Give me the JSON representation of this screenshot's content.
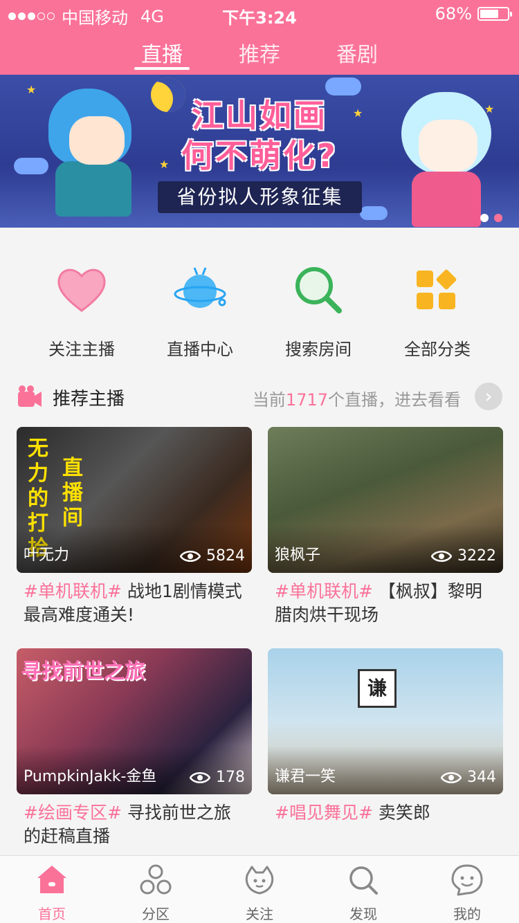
{
  "status_bar": {
    "carrier": "中国移动",
    "network": "4G",
    "time": "下午3:24",
    "battery_text": "68%",
    "battery_level": 0.68
  },
  "top_tabs": [
    {
      "label": "直播",
      "active": true
    },
    {
      "label": "推荐",
      "active": false
    },
    {
      "label": "番剧",
      "active": false
    }
  ],
  "banner": {
    "title_line1": "江山如画",
    "title_line2": "何不萌化?",
    "subtitle": "省份拟人形象征集",
    "page_index": 2,
    "page_count": 2
  },
  "quick_entries": [
    {
      "label": "关注主播",
      "icon": "heart-icon"
    },
    {
      "label": "直播中心",
      "icon": "planet-icon"
    },
    {
      "label": "搜索房间",
      "icon": "search-room-icon"
    },
    {
      "label": "全部分类",
      "icon": "category-grid-icon"
    }
  ],
  "section": {
    "title": "推荐主播",
    "prefix": "当前",
    "count": "1717",
    "suffix": "个直播，进去看看"
  },
  "cards": [
    {
      "uploader": "叶无力",
      "views": "5824",
      "tag": "#单机联机#",
      "title": " 战地1剧情模式最高难度通关!",
      "thumb_text": [
        "无",
        "力",
        "的",
        "打",
        "拾"
      ],
      "thumb_text2": [
        "直",
        "播",
        "间"
      ]
    },
    {
      "uploader": "狼枫子",
      "views": "3222",
      "tag": "#单机联机#",
      "title": " 【枫叔】黎明腊肉烘干现场"
    },
    {
      "uploader": "PumpkinJakk-金鱼",
      "views": "178",
      "tag": "#绘画专区#",
      "title": " 寻找前世之旅的赶稿直播",
      "thumb_logo": "寻找前世之旅"
    },
    {
      "uploader": "谦君一笑",
      "views": "344",
      "tag": "#唱见舞见#",
      "title": " 卖笑郎",
      "thumb_badge": "谦"
    }
  ],
  "bottom_tabs": [
    {
      "label": "首页",
      "icon": "home-icon",
      "active": true
    },
    {
      "label": "分区",
      "icon": "circles-icon",
      "active": false
    },
    {
      "label": "关注",
      "icon": "follow-face-icon",
      "active": false
    },
    {
      "label": "发现",
      "icon": "discover-search-icon",
      "active": false
    },
    {
      "label": "我的",
      "icon": "smile-face-icon",
      "active": false
    }
  ],
  "colors": {
    "brand": "#fb7299",
    "banner_bg": "#3b4ea8",
    "accent_yellow": "#f8b521",
    "accent_green": "#3bb35a",
    "accent_blue": "#27a4f2"
  }
}
